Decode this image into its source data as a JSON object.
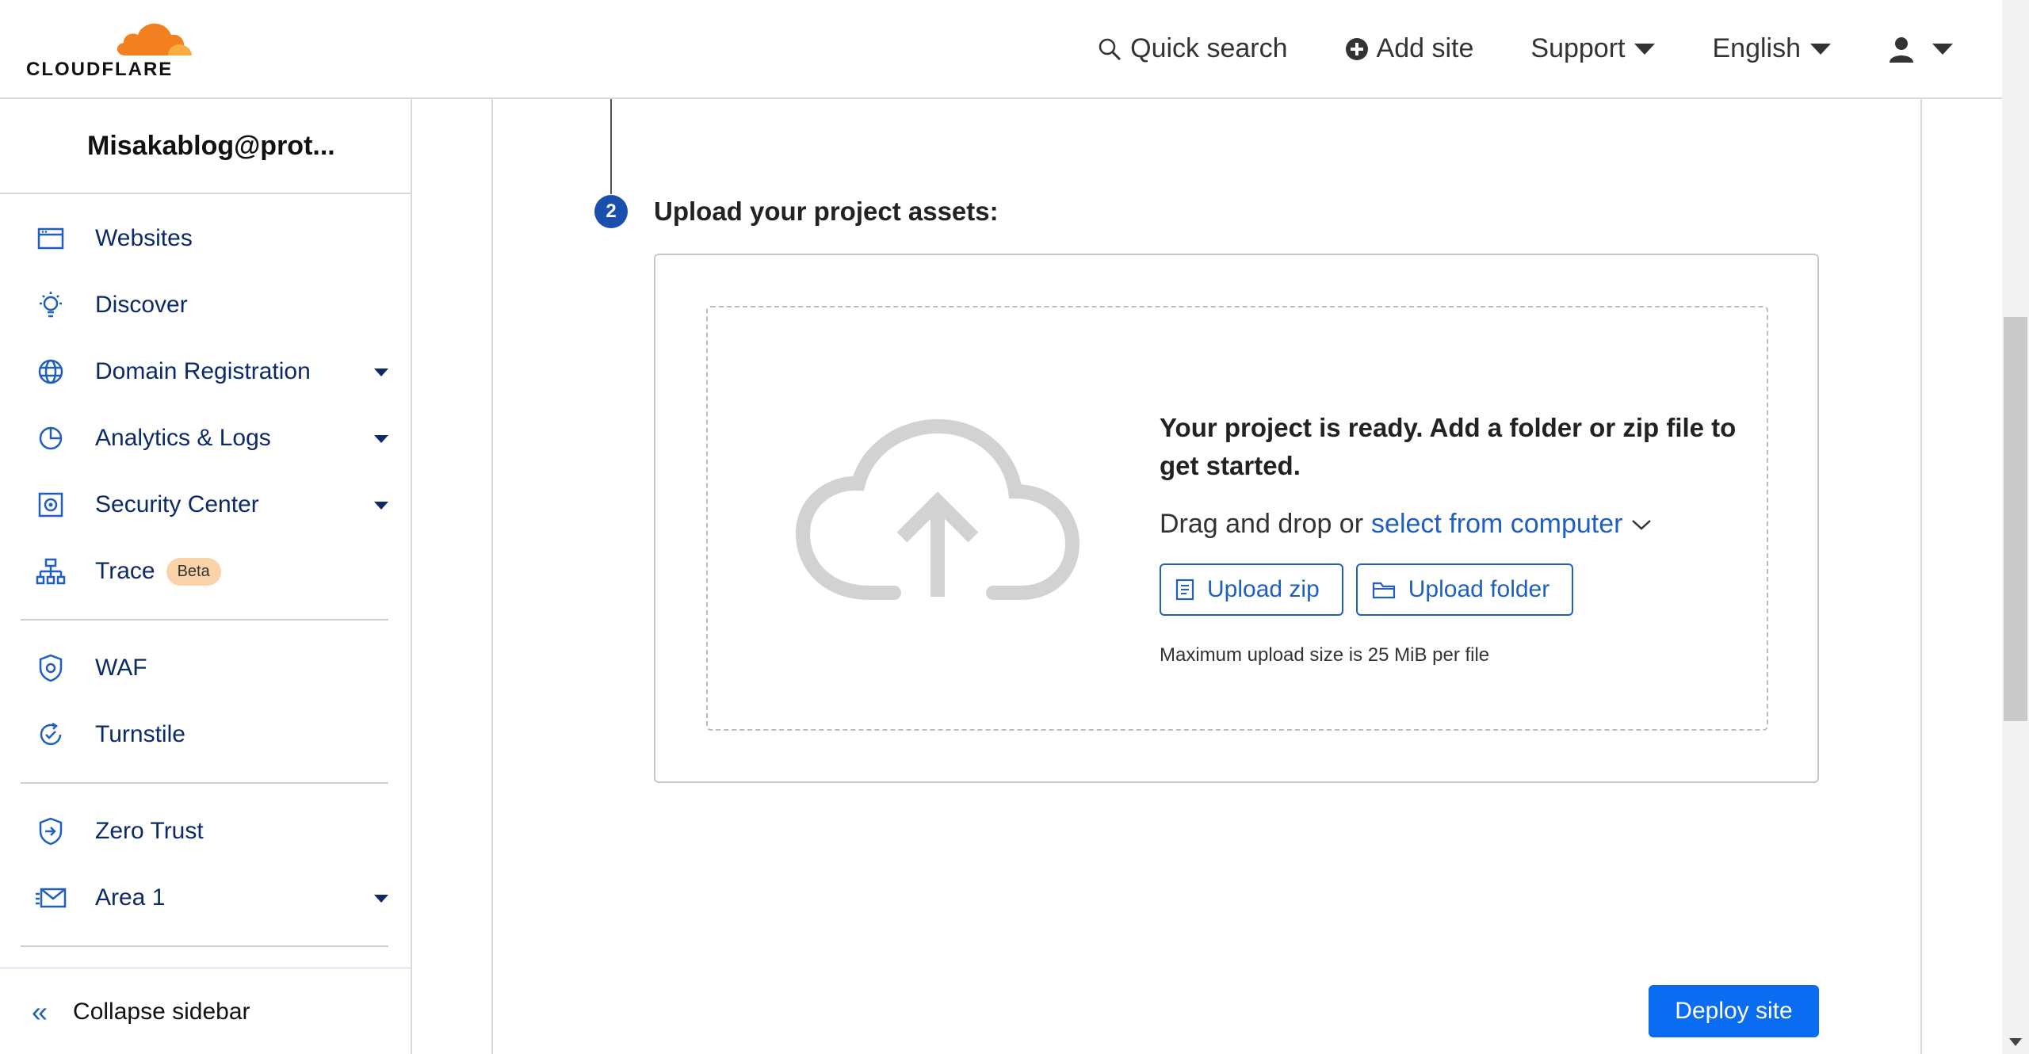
{
  "brand": {
    "name": "CLOUDFLARE",
    "orange": "#f38020",
    "orange_light": "#fbad41"
  },
  "topnav": {
    "search_label": "Quick search",
    "add_site_label": "Add site",
    "support_label": "Support",
    "language_label": "English"
  },
  "sidebar": {
    "account": "Misakablog@prot...",
    "items": [
      {
        "label": "Websites",
        "icon": "browser-window-icon",
        "has_dropdown": false
      },
      {
        "label": "Discover",
        "icon": "lightbulb-icon",
        "has_dropdown": false
      },
      {
        "label": "Domain Registration",
        "icon": "globe-icon",
        "has_dropdown": true
      },
      {
        "label": "Analytics & Logs",
        "icon": "pie-chart-icon",
        "has_dropdown": true
      },
      {
        "label": "Security Center",
        "icon": "security-center-icon",
        "has_dropdown": true
      },
      {
        "label": "Trace",
        "icon": "sitemap-icon",
        "has_dropdown": false,
        "badge": "Beta"
      },
      {
        "label": "WAF",
        "icon": "shield-gear-icon",
        "has_dropdown": false
      },
      {
        "label": "Turnstile",
        "icon": "turnstile-icon",
        "has_dropdown": false
      },
      {
        "label": "Zero Trust",
        "icon": "zero-trust-icon",
        "has_dropdown": false
      },
      {
        "label": "Area 1",
        "icon": "envelope-icon",
        "has_dropdown": true
      }
    ],
    "collapse_label": "Collapse sidebar"
  },
  "step": {
    "number": "2",
    "title": "Upload your project assets:"
  },
  "upload": {
    "title": "Your project is ready. Add a folder or zip file to get started.",
    "drag_prefix": "Drag and drop or",
    "select_link": "select from computer",
    "zip_button": "Upload zip",
    "folder_button": "Upload folder",
    "max_size_note": "Maximum upload size is 25 MiB per file"
  },
  "actions": {
    "deploy_label": "Deploy site"
  },
  "colors": {
    "accent": "#1f5fbf",
    "deploy_bg": "#0a6cf0",
    "step_badge": "#1b4fae",
    "beta_badge": "#fbd3a8"
  }
}
